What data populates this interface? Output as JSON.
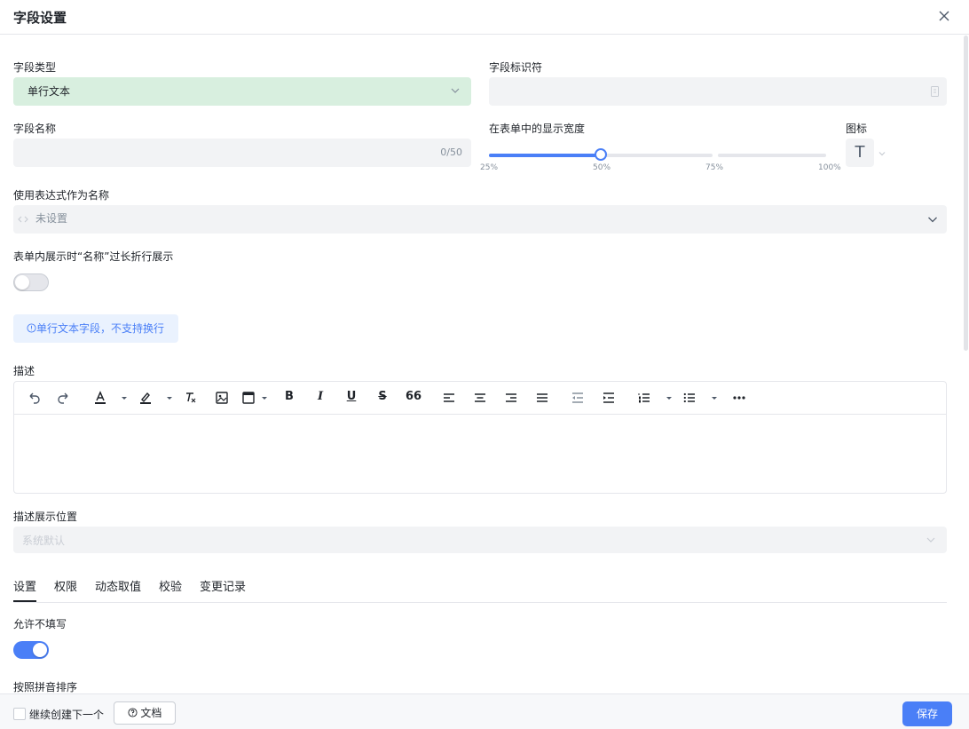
{
  "dialog": {
    "title": "字段设置"
  },
  "field_type": {
    "label": "字段类型",
    "value": "单行文本"
  },
  "field_identifier": {
    "label": "字段标识符",
    "value": ""
  },
  "field_name": {
    "label": "字段名称",
    "value": "",
    "counter": "0/50"
  },
  "display_width": {
    "label": "在表单中的显示宽度",
    "ticks": [
      "25%",
      "50%",
      "75%",
      "100%"
    ],
    "value_percent": 50
  },
  "icon_picker": {
    "label": "图标",
    "glyph": "T"
  },
  "expression_name": {
    "label": "使用表达式作为名称",
    "placeholder": "未设置"
  },
  "wrap_name": {
    "label": "表单内展示时“名称”过长折行展示",
    "enabled": false
  },
  "tip": {
    "text": "单行文本字段，不支持换行"
  },
  "description": {
    "label": "描述"
  },
  "description_position": {
    "label": "描述展示位置",
    "value": "系统默认"
  },
  "tabs": [
    {
      "label": "设置",
      "active": true
    },
    {
      "label": "权限"
    },
    {
      "label": "动态取值"
    },
    {
      "label": "校验"
    },
    {
      "label": "变更记录"
    }
  ],
  "allow_empty": {
    "label": "允许不填写",
    "enabled": true
  },
  "pinyin_sort": {
    "label": "按照拼音排序"
  },
  "footer": {
    "continue_label": "继续创建下一个",
    "doc_label": "文档",
    "save_label": "保存"
  },
  "colors": {
    "accent": "#4a7ff7",
    "type_select_bg": "#d8efdf"
  }
}
